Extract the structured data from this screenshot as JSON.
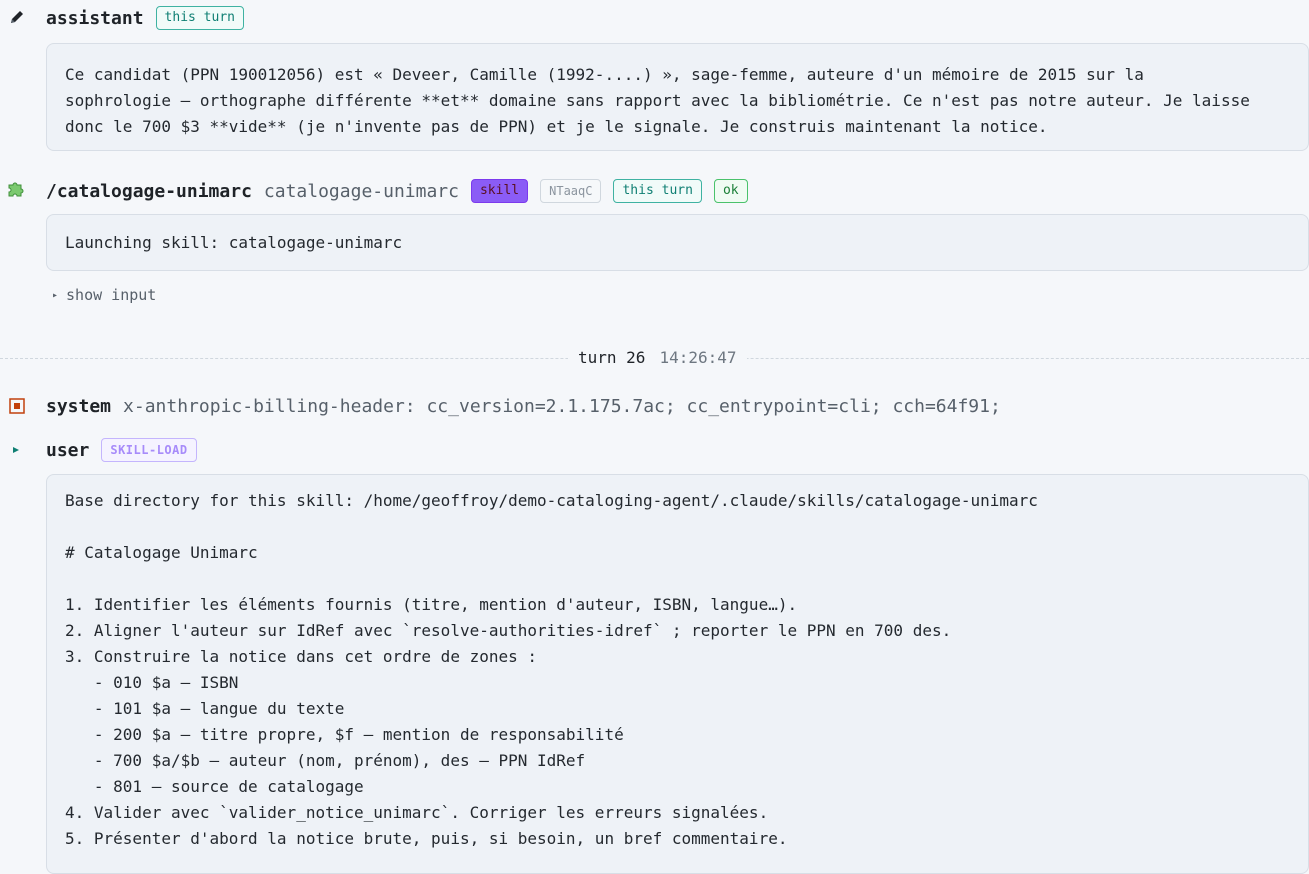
{
  "assistant": {
    "role": "assistant",
    "tag": "this turn",
    "text": "Ce candidat (PPN 190012056) est « Deveer, Camille (1992-....) », sage-femme, auteure d'un mémoire de 2015 sur la\nsophrologie — orthographe différente **et** domaine sans rapport avec la bibliométrie. Ce n'est pas notre auteur. Je laisse\ndonc le 700 $3 **vide** (je n'invente pas de PPN) et je le signale. Je construis maintenant la notice."
  },
  "skill_call": {
    "command": "/catalogage-unimarc",
    "name": "catalogage-unimarc",
    "tag_skill": "skill",
    "tag_id": "NTaaqC",
    "tag_turn": "this turn",
    "tag_status": "ok",
    "output": "Launching skill: catalogage-unimarc",
    "show_input": "show input"
  },
  "turn": {
    "label": "turn 26",
    "time": "14:26:47"
  },
  "system": {
    "role": "system",
    "text": "x-anthropic-billing-header: cc_version=2.1.175.7ac; cc_entrypoint=cli; cch=64f91;"
  },
  "user": {
    "role": "user",
    "tag": "SKILL-LOAD",
    "text": "Base directory for this skill: /home/geoffroy/demo-cataloging-agent/.claude/skills/catalogage-unimarc\n\n# Catalogage Unimarc\n\n1. Identifier les éléments fournis (titre, mention d'auteur, ISBN, langue…).\n2. Aligner l'auteur sur IdRef avec `resolve-authorities-idref` ; reporter le PPN en 700 des.\n3. Construire la notice dans cet ordre de zones :\n   - 010 $a — ISBN\n   - 101 $a — langue du texte\n   - 200 $a — titre propre, $f — mention de responsabilité\n   - 700 $a/$b — auteur (nom, prénom), des — PPN IdRef\n   - 801 — source de catalogage\n4. Valider avec `valider_notice_unimarc`. Corriger les erreurs signalées.\n5. Présenter d'abord la notice brute, puis, si besoin, un bref commentaire."
  }
}
